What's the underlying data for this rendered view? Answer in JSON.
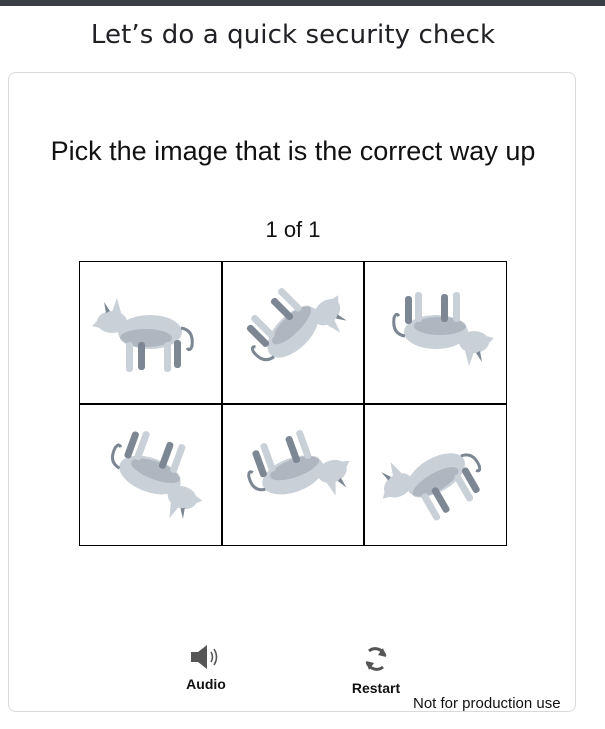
{
  "header": {
    "title": "Let’s do a quick security check"
  },
  "challenge": {
    "prompt": "Pick the image that is the correct way up",
    "progress": "1 of 1",
    "tiles": [
      {
        "index": 1,
        "orientation_deg": 0
      },
      {
        "index": 2,
        "orientation_deg": 135
      },
      {
        "index": 3,
        "orientation_deg": 180
      },
      {
        "index": 4,
        "orientation_deg": 200
      },
      {
        "index": 5,
        "orientation_deg": 160
      },
      {
        "index": 6,
        "orientation_deg": -30
      }
    ]
  },
  "controls": {
    "audio_label": "Audio",
    "restart_label": "Restart",
    "audio_icon": "speaker-icon",
    "restart_icon": "refresh-icon"
  },
  "footer": {
    "note": "Not for production use"
  },
  "colors": {
    "topbar": "#3a3d42",
    "animal_body": "#c9d0d8",
    "animal_shadow": "#7d8794",
    "icon": "#555555"
  }
}
